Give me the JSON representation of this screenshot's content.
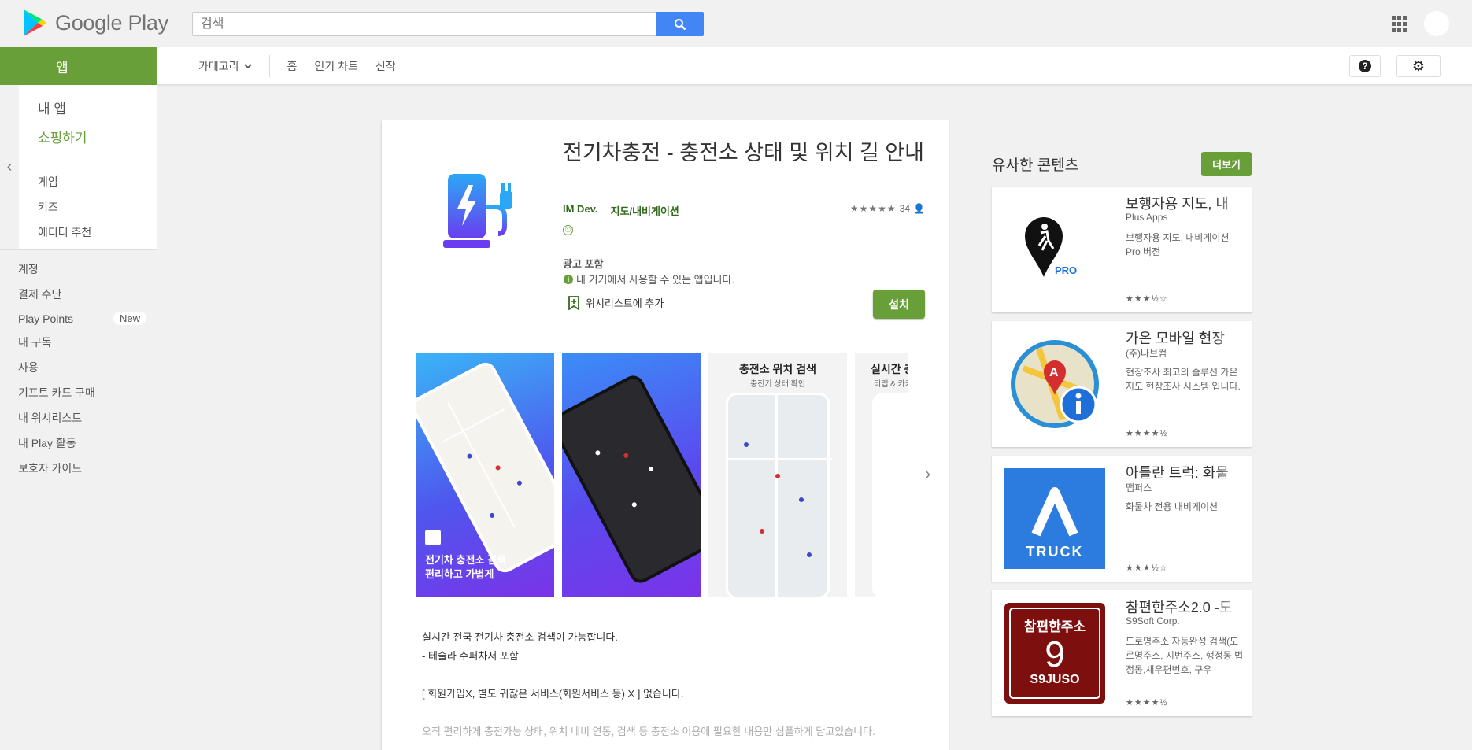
{
  "header": {
    "brand": "Google Play",
    "search_placeholder": "검색"
  },
  "nav": {
    "apps_tab": "앱",
    "category": "카테고리",
    "links": [
      "홈",
      "인기 차트",
      "신작"
    ]
  },
  "sidebar": {
    "top_items": [
      "내 앱",
      "쇼핑하기"
    ],
    "sub_items": [
      "게임",
      "키즈",
      "에디터 추천"
    ],
    "bottom_items": [
      "계정",
      "결제 수단",
      "Play Points",
      "내 구독",
      "사용",
      "기프트 카드 구매",
      "내 위시리스트",
      "내 Play 활동",
      "보호자 가이드"
    ],
    "new_badge": "New"
  },
  "app": {
    "title": "전기차충전 - 충전소 상태 및 위치 길 안내",
    "developer": "IM Dev.",
    "category": "지도/내비게이션",
    "rating_count": "34",
    "age_rating": "①",
    "ad_label": "광고 포함",
    "compat_text": "내 기기에서 사용할 수 있는 앱입니다.",
    "wishlist_label": "위시리스트에 추가",
    "install_label": "설치",
    "screenshots": {
      "caption_1_line1": "전기차 충전소 검색",
      "caption_1_line2": "편리하고 가볍게",
      "head_3": "충전소 위치 검색",
      "sub_3": "충전기 상태 확인",
      "head_4": "실시간 충전",
      "sub_4": "티맵 & 카카오"
    },
    "description": [
      "실시간 전국 전기차 충전소 검색이 가능합니다.",
      "- 테슬라 수퍼차저 포함",
      "",
      "[ 회원가입X, 별도 귀찮은 서비스(회원서비스 등) X ] 없습니다.",
      "",
      "오직 편리하게 충전가능 상태, 위치 네비 연동, 검색 등 충전소 이용에 필요한 내용만 심플하게 담고있습니다."
    ]
  },
  "similar": {
    "title": "유사한 콘텐츠",
    "more_label": "더보기",
    "items": [
      {
        "name": "보행자용 지도, 내",
        "dev": "Plus Apps",
        "desc": "보행자용 지도, 내비게이션 Pro 버전",
        "stars": "★★★½☆",
        "icon": "pedestrian-pin-icon",
        "icon_text": "PRO"
      },
      {
        "name": "가온 모바일 현장",
        "dev": "(주)나브컴",
        "desc": "현장조사 최고의 솔루션 가온지도 현장조사 시스템 입니다.",
        "stars": "★★★★½",
        "icon": "map-info-icon",
        "icon_text": "A"
      },
      {
        "name": "아틀란 트럭: 화물",
        "dev": "맵퍼스",
        "desc": "화물차 전용 내비게이션",
        "stars": "★★★½☆",
        "icon": "truck-icon",
        "icon_text": "TRUCK"
      },
      {
        "name": "참편한주소2.0 -도",
        "dev": "S9Soft Corp.",
        "desc": "도로명주소 자동완성 검색(도로명주소, 지번주소, 행정동,법정동,새우편번호, 구우",
        "stars": "★★★★½",
        "icon": "address-9-icon",
        "icon_text_top": "참편한주소",
        "icon_text_mid": "9",
        "icon_text_bottom": "S9JUSO"
      }
    ]
  },
  "colors": {
    "accent_green": "#689f38",
    "search_blue": "#4285f4",
    "dark_green_link": "#33691e"
  }
}
